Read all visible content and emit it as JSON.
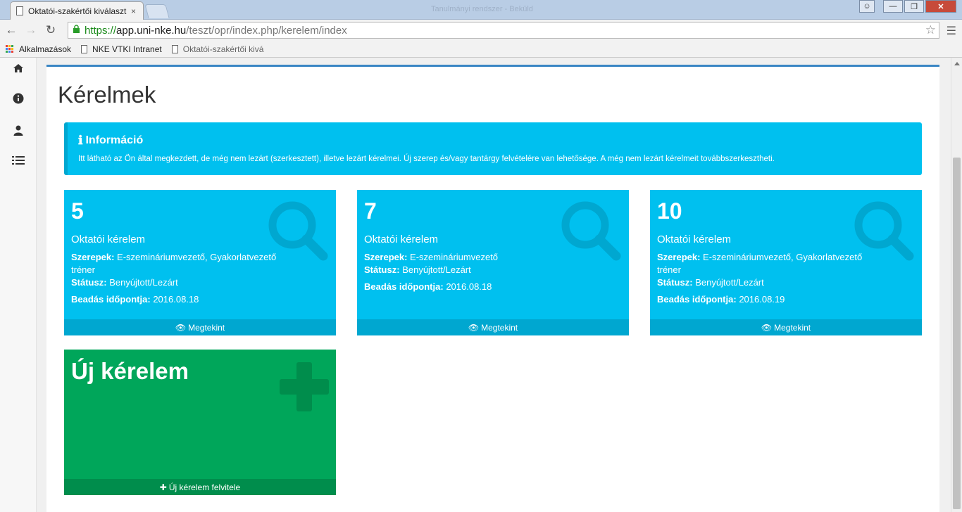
{
  "browser": {
    "tab_title": "Oktatói-szakértői kiválaszt",
    "tab_close": "×",
    "window_title": "Tanulmányi rendszer - Beküld",
    "url_scheme": "https://",
    "url_host": "app.uni-nke.hu",
    "url_path": "/teszt/opr/index.php/kerelem/index",
    "bookmarks": [
      {
        "label": "Alkalmazások",
        "icon": "apps-grid-icon"
      },
      {
        "label": "NKE VTKI Intranet",
        "icon": "page-icon"
      },
      {
        "label": "Oktatói-szakértői kivá",
        "icon": "page-icon"
      }
    ]
  },
  "sidebar": {
    "items": [
      {
        "icon": "home-icon"
      },
      {
        "icon": "info-icon"
      },
      {
        "icon": "user-icon"
      },
      {
        "icon": "list-icon"
      }
    ]
  },
  "page": {
    "title": "Kérelmek"
  },
  "info_box": {
    "icon": "ℹ",
    "heading": "Információ",
    "text": "Itt látható az Ön által megkezdett, de még nem lezárt (szerkesztett), illetve lezárt kérelmei. Új szerep és/vagy tantárgy felvételére van lehetősége. A még nem lezárt kérelmeit továbbszerkesztheti."
  },
  "cards": [
    {
      "number": "5",
      "kind": "Oktatói kérelem",
      "roles_label": "Szerepek:",
      "roles": "E-szemináriumvezető, Gyakorlatvezető tréner",
      "status_label": "Státusz:",
      "status": "Benyújtott/Lezárt",
      "date_label": "Beadás időpontja:",
      "date": "2016.08.18",
      "action": "Megtekint"
    },
    {
      "number": "7",
      "kind": "Oktatói kérelem",
      "roles_label": "Szerepek:",
      "roles": "E-szemináriumvezető",
      "status_label": "Státusz:",
      "status": "Benyújtott/Lezárt",
      "date_label": "Beadás időpontja:",
      "date": "2016.08.18",
      "action": "Megtekint"
    },
    {
      "number": "10",
      "kind": "Oktatói kérelem",
      "roles_label": "Szerepek:",
      "roles": "E-szemináriumvezető, Gyakorlatvezető tréner",
      "status_label": "Státusz:",
      "status": "Benyújtott/Lezárt",
      "date_label": "Beadás időpontja:",
      "date": "2016.08.19",
      "action": "Megtekint"
    }
  ],
  "new_request": {
    "title": "Új kérelem",
    "action": "Új kérelem felvitele"
  },
  "colors": {
    "info": "#00c0ef",
    "info_dark": "#00a7d0",
    "success": "#00a65a",
    "success_dark": "#008d4c",
    "panel_accent": "#3a86c4"
  }
}
